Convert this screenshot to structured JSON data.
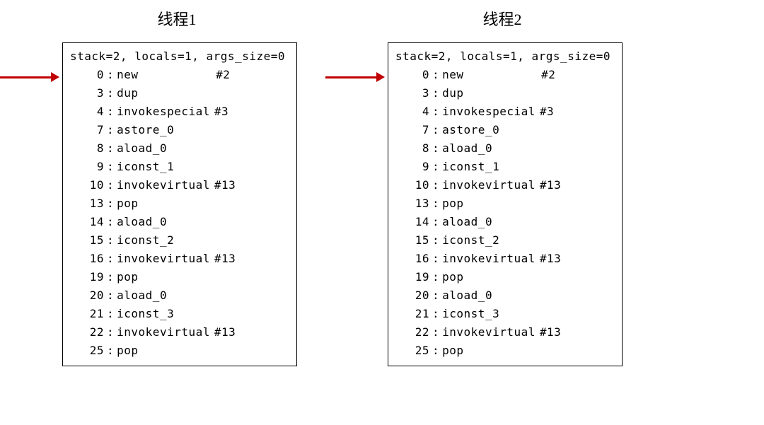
{
  "threads": [
    {
      "title": "线程1"
    },
    {
      "title": "线程2"
    }
  ],
  "bytecode": {
    "header": "stack=2, locals=1, args_size=0",
    "lines": [
      {
        "offset": "0",
        "mnemonic": "new",
        "ref": "#2"
      },
      {
        "offset": "3",
        "mnemonic": "dup",
        "ref": ""
      },
      {
        "offset": "4",
        "mnemonic": "invokespecial",
        "ref": "#3"
      },
      {
        "offset": "7",
        "mnemonic": "astore_0",
        "ref": ""
      },
      {
        "offset": "8",
        "mnemonic": "aload_0",
        "ref": ""
      },
      {
        "offset": "9",
        "mnemonic": "iconst_1",
        "ref": ""
      },
      {
        "offset": "10",
        "mnemonic": "invokevirtual",
        "ref": "#13"
      },
      {
        "offset": "13",
        "mnemonic": "pop",
        "ref": ""
      },
      {
        "offset": "14",
        "mnemonic": "aload_0",
        "ref": ""
      },
      {
        "offset": "15",
        "mnemonic": "iconst_2",
        "ref": ""
      },
      {
        "offset": "16",
        "mnemonic": "invokevirtual",
        "ref": "#13"
      },
      {
        "offset": "19",
        "mnemonic": "pop",
        "ref": ""
      },
      {
        "offset": "20",
        "mnemonic": "aload_0",
        "ref": ""
      },
      {
        "offset": "21",
        "mnemonic": "iconst_3",
        "ref": ""
      },
      {
        "offset": "22",
        "mnemonic": "invokevirtual",
        "ref": "#13"
      },
      {
        "offset": "25",
        "mnemonic": "pop",
        "ref": ""
      }
    ]
  },
  "arrow_color": "#c00000"
}
